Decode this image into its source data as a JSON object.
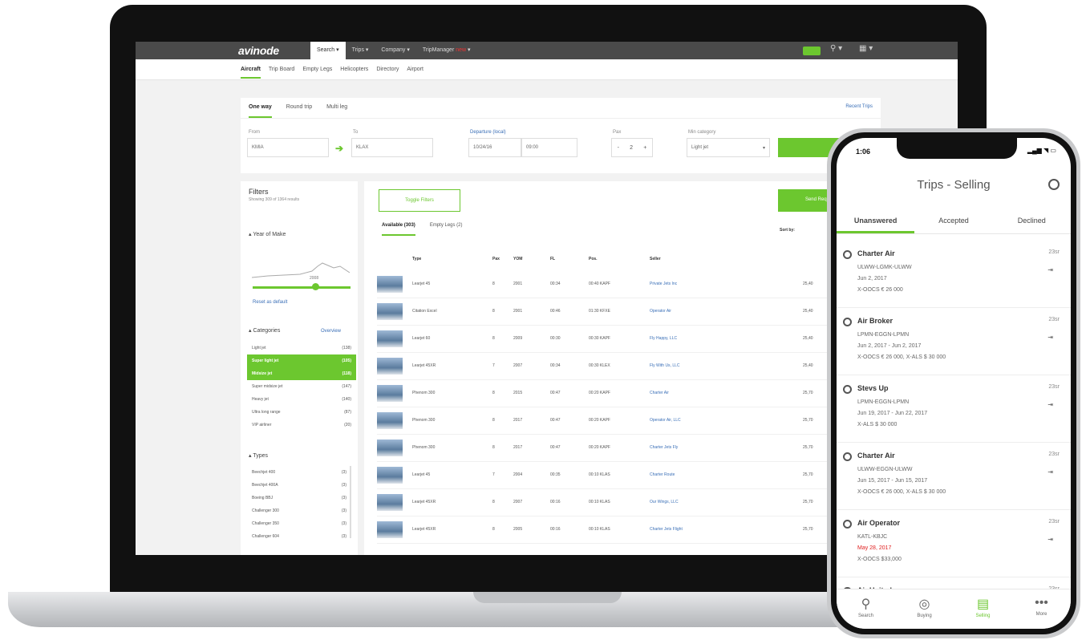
{
  "laptop": {
    "topbar": {
      "logo": "avinode",
      "nav": [
        "Search",
        "Trips",
        "Company",
        "TripManager"
      ],
      "tm_badge": "new"
    },
    "subnav": [
      "Aircraft",
      "Trip Board",
      "Empty Legs",
      "Helicopters",
      "Directory",
      "Airport"
    ],
    "search": {
      "trip_types": [
        "One way",
        "Round trip",
        "Multi leg"
      ],
      "recent_trips": "Recent Trips",
      "from_label": "From",
      "from_value": "KMIA",
      "to_label": "To",
      "to_value": "KLAX",
      "departure_label": "Departure (local)",
      "date_value": "10/24/16",
      "time_value": "09:00",
      "pax_label": "Pax",
      "pax_value": "2",
      "category_label": "Min category",
      "category_value": "Light jet",
      "search_button": "Search"
    },
    "filters": {
      "title": "Filters",
      "count": "Showing 309 of 1364 results",
      "year_title": "Year of Make",
      "year_value": "2008",
      "reset": "Reset as default",
      "categories_title": "Categories",
      "overview": "Overview",
      "categories": [
        {
          "name": "Light jet",
          "count": "(138)",
          "selected": false
        },
        {
          "name": "Super light jet",
          "count": "(105)",
          "selected": true
        },
        {
          "name": "Midsize jet",
          "count": "(118)",
          "selected": true
        },
        {
          "name": "Super midsize jet",
          "count": "(147)",
          "selected": false
        },
        {
          "name": "Heavy jet",
          "count": "(140)",
          "selected": false
        },
        {
          "name": "Ultra long range",
          "count": "(87)",
          "selected": false
        },
        {
          "name": "VIP airliner",
          "count": "(20)",
          "selected": false
        }
      ],
      "types_title": "Types",
      "types": [
        {
          "name": "Beechjet 400",
          "count": "(3)"
        },
        {
          "name": "Beechjet 400A",
          "count": "(3)"
        },
        {
          "name": "Boeing BBJ",
          "count": "(3)"
        },
        {
          "name": "Challenger 300",
          "count": "(3)"
        },
        {
          "name": "Challenger 350",
          "count": "(3)"
        },
        {
          "name": "Challenger 604",
          "count": "(3)"
        }
      ]
    },
    "results": {
      "toggle_filters": "Toggle Filters",
      "send_request": "Send Request",
      "tabs": [
        "Available (303)",
        "Empty Legs (2)"
      ],
      "sort_label": "Sort by:",
      "sort_value": "Price",
      "columns": [
        "Type",
        "Pax",
        "YOM",
        "FL",
        "Pos.",
        "Seller",
        "Price"
      ],
      "rows": [
        {
          "type": "Learjet 45",
          "pax": "8",
          "yom": "2001",
          "fl": "00:34",
          "pos": "00:40 KAPF",
          "seller": "Private Jets Inc",
          "price": "25,40"
        },
        {
          "type": "Citation Excel",
          "pax": "8",
          "yom": "2001",
          "fl": "00:46",
          "pos": "01:30 KFXE",
          "seller": "Operator Air",
          "price": "25,40"
        },
        {
          "type": "Learjet 60",
          "pax": "8",
          "yom": "2009",
          "fl": "00:30",
          "pos": "00:30 KAPF",
          "seller": "Fly Happy, LLC",
          "price": "25,40"
        },
        {
          "type": "Learjet 45XR",
          "pax": "7",
          "yom": "2007",
          "fl": "00:34",
          "pos": "00:30 KLEX",
          "seller": "Fly With Us, LLC",
          "price": "25,40"
        },
        {
          "type": "Phenom 300",
          "pax": "8",
          "yom": "2015",
          "fl": "00:47",
          "pos": "00:20 KAPF",
          "seller": "Charter Air",
          "price": "25,70"
        },
        {
          "type": "Phenom 300",
          "pax": "8",
          "yom": "2017",
          "fl": "00:47",
          "pos": "00:20 KAPF",
          "seller": "Operator Air, LLC",
          "price": "25,70"
        },
        {
          "type": "Phenom 300",
          "pax": "8",
          "yom": "2017",
          "fl": "00:47",
          "pos": "00:20 KAPF",
          "seller": "Charter Jets Fly",
          "price": "25,70"
        },
        {
          "type": "Learjet 45",
          "pax": "7",
          "yom": "2004",
          "fl": "00:35",
          "pos": "00:10 KLAS",
          "seller": "Charter Route",
          "price": "25,70"
        },
        {
          "type": "Learjet 45XR",
          "pax": "8",
          "yom": "2007",
          "fl": "00:16",
          "pos": "00:10 KLAS",
          "seller": "Our Wings, LLC",
          "price": "25,70"
        },
        {
          "type": "Learjet 45XR",
          "pax": "8",
          "yom": "2005",
          "fl": "00:16",
          "pos": "00:10 KLAS",
          "seller": "Charter Jets Flight",
          "price": "25,70"
        }
      ]
    }
  },
  "phone": {
    "time": "1:06",
    "title": "Trips - Selling",
    "tabs": [
      "Unanswered",
      "Accepted",
      "Declined"
    ],
    "cards": [
      {
        "title": "Charter Air",
        "route": "ULWW-LGMK-ULWW",
        "dates": "Jun 2, 2017",
        "price": "X-OOCS € 26 000",
        "date": "23sr",
        "red": false
      },
      {
        "title": "Air Broker",
        "route": "LPMN-EGGN-LPMN",
        "dates": "Jun 2, 2017 - Jun 2, 2017",
        "price": "X-OOCS € 26 000, X-ALS $ 30 000",
        "date": "23sr",
        "red": false
      },
      {
        "title": "Stevs Up",
        "route": "LPMN-EGGN-LPMN",
        "dates": "Jun 19, 2017 - Jun 22, 2017",
        "price": "X-ALS $ 30 000",
        "date": "23sr",
        "red": false
      },
      {
        "title": "Charter Air",
        "route": "ULWW-EGGN-ULWW",
        "dates": "Jun 15, 2017 - Jun 15, 2017",
        "price": "X-OOCS € 26 000, X-ALS $ 30 000",
        "date": "23sr",
        "red": false
      },
      {
        "title": "Air Operator",
        "route": "KATL-KBJC",
        "dates": "May 28, 2017",
        "price": "X-OOCS $33,000",
        "date": "23sr",
        "red": true
      },
      {
        "title": "Air United",
        "route": "",
        "dates": "",
        "price": "",
        "date": "23sr",
        "red": false
      }
    ],
    "tabbar": [
      "Search",
      "Buying",
      "Selling",
      "More"
    ]
  }
}
